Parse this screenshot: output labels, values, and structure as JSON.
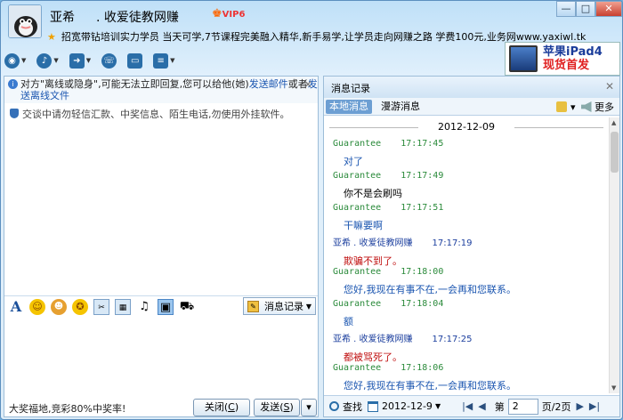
{
  "title": {
    "nickname": "亚希",
    "signature_name": ". 收爱徒教网赚",
    "vip_badge": "VIP6",
    "status_text": "招宽带钻培训实力学员 当天可学,7节课程完美融入精华,新手易学,让学员走向网赚之路 学费100元,业务网www.yaxiwl.tk"
  },
  "window_buttons": [
    "—",
    "□",
    "✕"
  ],
  "toolbar": [
    "video-icon",
    "mic-icon",
    "file-icon",
    "remote-icon",
    "screen-icon",
    "app-icon"
  ],
  "ad": {
    "line1": "苹果iPad4",
    "line2": "现货首发"
  },
  "notice": {
    "prefix": "对方\"离线或隐身\",可能无法立即回复,您可以给他(她)",
    "link1": "发送邮件",
    "middle": "或者",
    "link2": "发送离线文件"
  },
  "warning": "交谈中请勿轻信汇款、中奖信息、陌生电话,勿使用外挂软件。",
  "format_toolbar": {
    "msg_record_label": "消息记录"
  },
  "bottom": {
    "lottery": "大奖福地,竞彩80%中奖率!",
    "close_label": "关闭(",
    "close_key": "C",
    "close_tail": ")",
    "send_label": "发送(",
    "send_key": "S",
    "send_tail": ")"
  },
  "history": {
    "title": "消息记录",
    "tab_local": "本地消息",
    "tab_roam": "漫游消息",
    "more": "更多",
    "date": "2012-12-09",
    "messages": [
      {
        "sender": "Guarantee",
        "time": "17:17:45",
        "text": "对了",
        "style": "blue"
      },
      {
        "sender": "Guarantee",
        "time": "17:17:49",
        "text": "你不是会刷吗",
        "style": "black"
      },
      {
        "sender": "Guarantee",
        "time": "17:17:51",
        "text": "干嘛要啊",
        "style": "blue"
      },
      {
        "sender": "亚希   . 收爱徒教网赚",
        "time": "17:17:19",
        "text": "欺骗不到了。",
        "style": "red"
      },
      {
        "sender": "Guarantee",
        "time": "17:18:00",
        "text": "您好,我现在有事不在,一会再和您联系。",
        "style": "blue"
      },
      {
        "sender": "Guarantee",
        "time": "17:18:04",
        "text": "额",
        "style": "blue"
      },
      {
        "sender": "亚希   . 收爱徒教网赚",
        "time": "17:17:25",
        "text": "都被骂死了。",
        "style": "red"
      },
      {
        "sender": "Guarantee",
        "time": "17:18:06",
        "text": "您好,我现在有事不在,一会再和您联系。",
        "style": "blue"
      }
    ],
    "footer": {
      "search": "查找",
      "date": "2012-12-9",
      "page_prefix": "第",
      "page_value": "2",
      "page_suffix": "页/2页"
    }
  }
}
